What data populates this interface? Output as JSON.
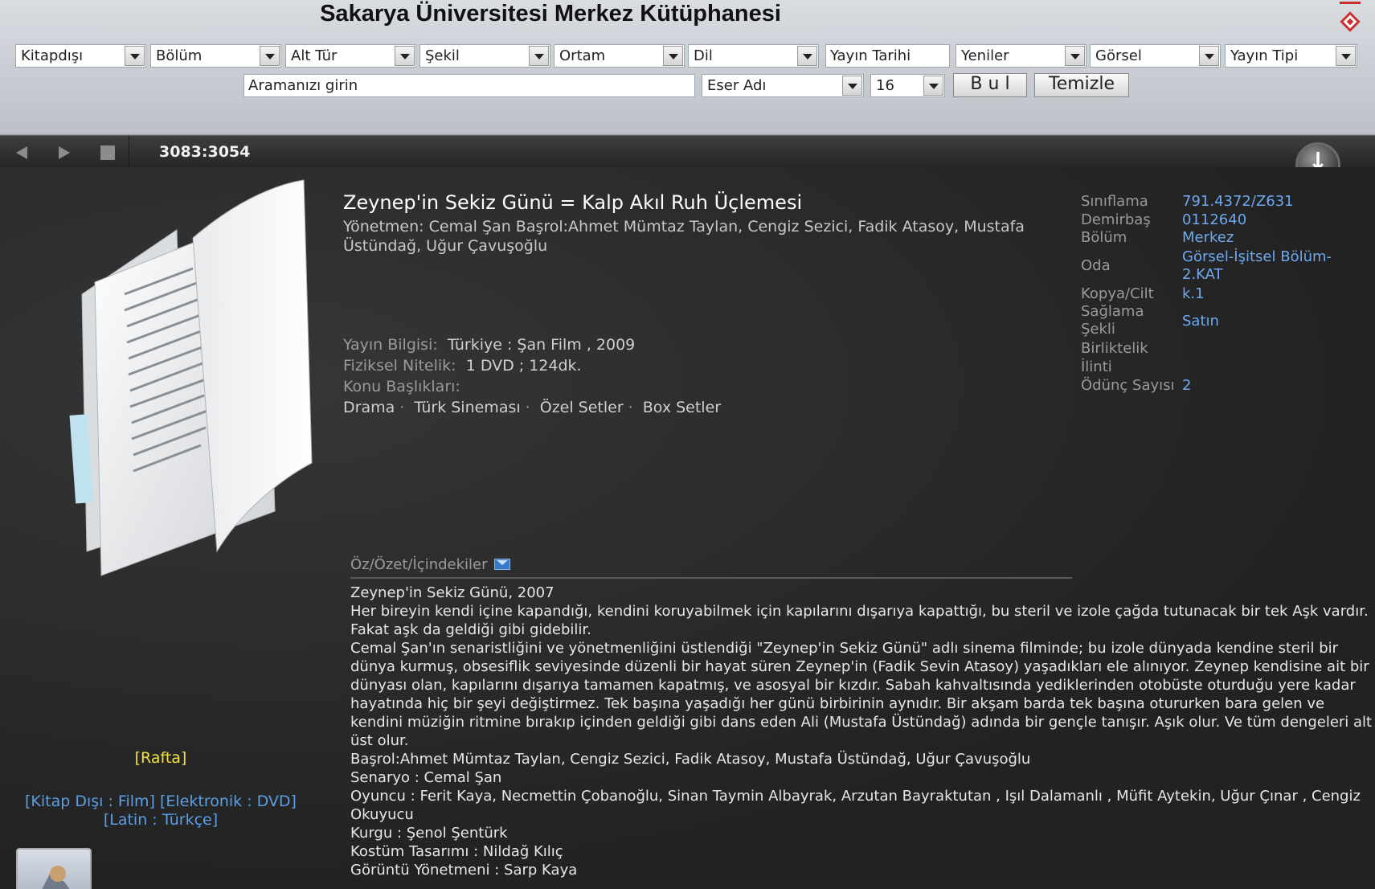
{
  "header": {
    "title": "Sakarya Üniversitesi Merkez Kütüphanesi",
    "filters": [
      "Kitapdışı",
      "Bölüm",
      "Alt Tür",
      "Şekil",
      "Ortam",
      "Dil",
      "Yayın Tarihi",
      "Yeniler",
      "Görsel",
      "Yayın Tipi"
    ],
    "search": {
      "placeholder": "Aramanızı girin",
      "field": "Eser Adı",
      "count": "16",
      "find_label": "B u l",
      "clear_label": "Temizle"
    }
  },
  "toolbar": {
    "counter": "3083:3054"
  },
  "left": {
    "rafta": "[Rafta]",
    "tags_line1": "[Kitap Dışı : Film] [Elektronik : DVD]",
    "tags_line2": "[Latin : Türkçe]"
  },
  "record": {
    "title": "Zeynep'in Sekiz Günü = Kalp Akıl Ruh Üçlemesi",
    "subtitle": "Yönetmen: Cemal Şan Başrol:Ahmet Mümtaz Taylan, Cengiz Sezici, Fadik Atasoy, Mustafa Üstündağ, Uğur Çavuşoğlu",
    "yayin_label": "Yayın Bilgisi:",
    "yayin_value": "Türkiye : Şan Film , 2009",
    "fiziksel_label": "Fiziksel Nitelik:",
    "fiziksel_value": "1 DVD ; 124dk.",
    "konu_label": "Konu Başlıkları:",
    "topics": [
      "Drama",
      "Türk Sineması",
      "Özel Setler",
      "Box Setler"
    ]
  },
  "meta": {
    "siniflama_label": "Sınıflama",
    "siniflama": "791.4372/Z631",
    "demirbas_label": "Demirbaş",
    "demirbas": "0112640",
    "bolum_label": "Bölüm",
    "bolum": "Merkez",
    "oda_label": "Oda",
    "oda": "Görsel-İşitsel Bölüm-2.KAT",
    "kopya_label": "Kopya/Cilt",
    "kopya": "k.1",
    "saglama_label": "Sağlama Şekli",
    "saglama": "Satın",
    "birliktelik_label": "Birliktelik",
    "ilinti_label": "İlinti",
    "odunc_label": "Ödünç Sayısı",
    "odunc": "2"
  },
  "abstract": {
    "label": "Öz/Özet/İçindekiler",
    "lines": [
      "Zeynep'in Sekiz Günü, 2007",
      "Her bireyin kendi içine kapandığı, kendini koruyabilmek için kapılarını dışarıya kapattığı, bu steril ve izole çağda tutunacak bir tek Aşk vardır. Fakat aşk da geldiği gibi gidebilir.",
      "Cemal Şan'ın senaristliğini ve yönetmenliğini üstlendiği \"Zeynep'in Sekiz Günü\" adlı sinema filminde; bu izole dünyada kendine steril bir dünya kurmuş, obsesiflik seviyesinde düzenli bir hayat süren Zeynep'in (Fadik Sevin Atasoy) yaşadıkları ele alınıyor. Zeynep kendisine ait bir dünyası olan, kapılarını dışarıya tamamen kapatmış, ve asosyal bir kızdır. Sabah kahvaltısında yediklerinden otobüste oturduğu yere kadar hayatında hiç bir şeyi değiştirmez. Tek başına yaşadığı her günü birbirinin aynıdır. Bir akşam barda tek başına otururken bara gelen ve kendini müziğin ritmine bırakıp içinden geldiği gibi dans eden Ali (Mustafa Üstündağ) adında bir gençle tanışır. Aşık olur. Ve tüm dengeleri alt üst olur.",
      "Başrol:Ahmet Mümtaz Taylan, Cengiz Sezici, Fadik Atasoy, Mustafa Üstündağ, Uğur Çavuşoğlu",
      "Senaryo : Cemal Şan",
      "Oyuncu : Ferit Kaya, Necmettin Çobanoğlu, Sinan Taymin Albayrak, Arzutan Bayraktutan , Işıl Dalamanlı , Müfit Aytekin, Uğur Çınar , Cengiz Okuyucu",
      "Kurgu : Şenol Şentürk",
      "Kostüm Tasarımı : Nildağ Kılıç",
      "Görüntü Yönetmeni : Sarp Kaya"
    ]
  }
}
